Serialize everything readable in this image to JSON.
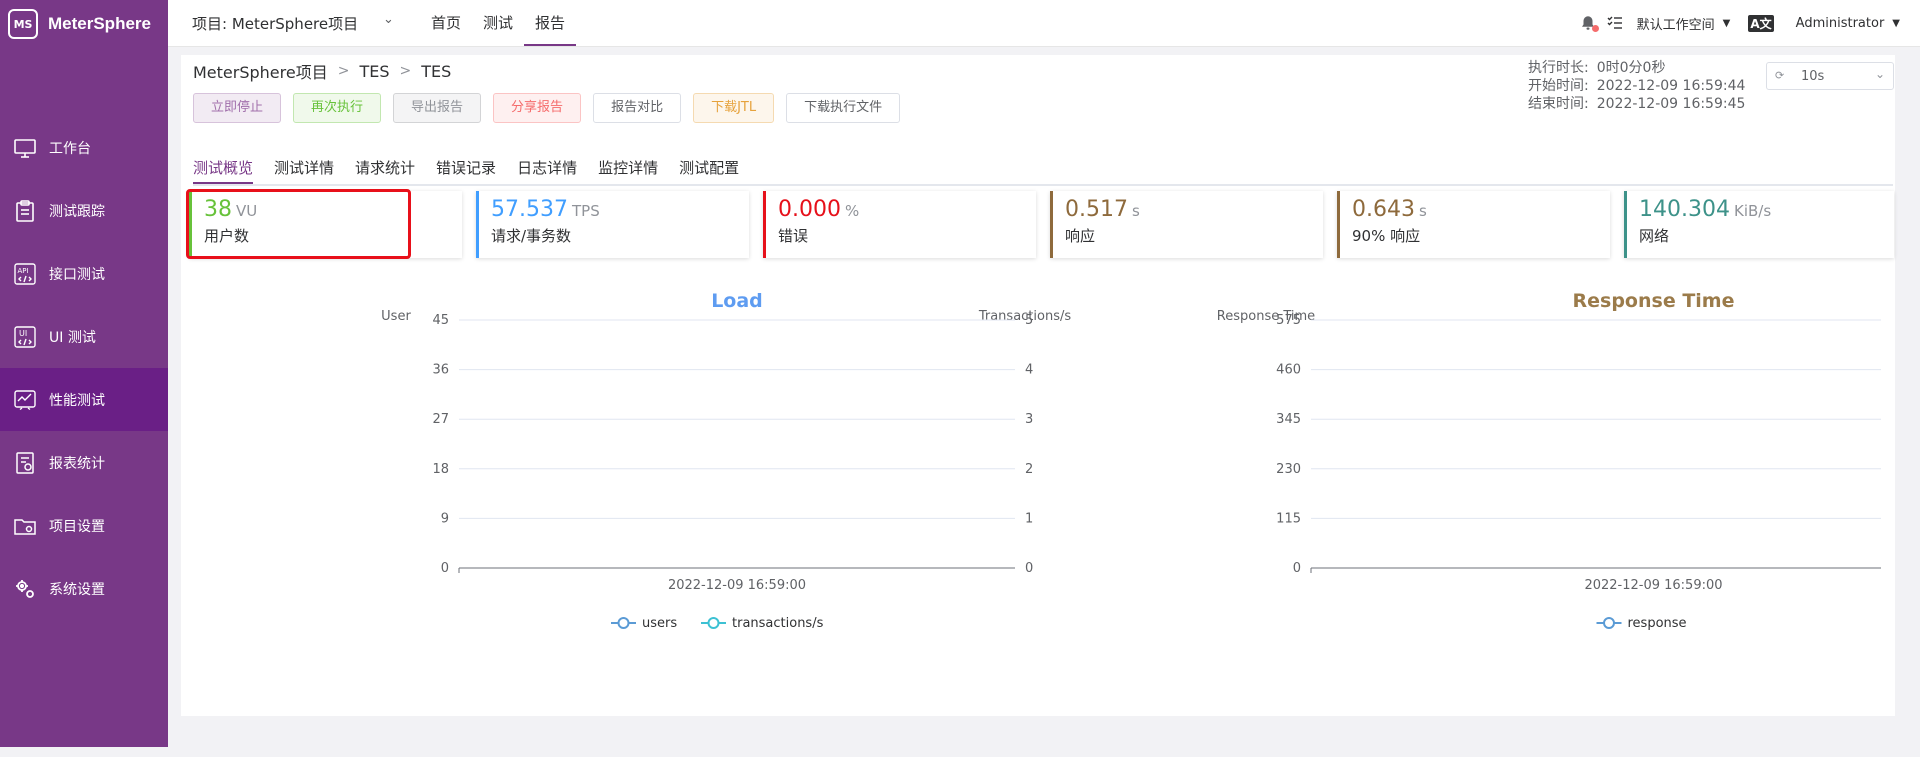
{
  "sidebar": {
    "logo_mark": "MS",
    "logo_text": "MeterSphere",
    "items": [
      {
        "label": "工作台",
        "icon": "monitor-icon"
      },
      {
        "label": "测试跟踪",
        "icon": "clipboard-icon"
      },
      {
        "label": "接口测试",
        "icon": "api-icon"
      },
      {
        "label": "UI 测试",
        "icon": "ui-icon"
      },
      {
        "label": "性能测试",
        "icon": "performance-icon"
      },
      {
        "label": "报表统计",
        "icon": "report-icon"
      },
      {
        "label": "项目设置",
        "icon": "folder-settings-icon"
      },
      {
        "label": "系统设置",
        "icon": "gears-icon"
      }
    ],
    "active_index": 4
  },
  "header": {
    "project": "项目: MeterSphere项目",
    "nav": [
      "首页",
      "测试",
      "报告"
    ],
    "active_nav": 2,
    "workspace": "默认工作空间",
    "user": "Administrator"
  },
  "report": {
    "breadcrumb": [
      "MeterSphere项目",
      "TES",
      "TES"
    ],
    "buttons": {
      "stop": "立即停止",
      "rerun": "再次执行",
      "export": "导出报告",
      "share": "分享报告",
      "compare": "报告对比",
      "jtl": "下载JTL",
      "download_files": "下载执行文件"
    },
    "duration_label": "执行时长:",
    "duration": "0时0分0秒",
    "start_label": "开始时间:",
    "start": "2022-12-09 16:59:44",
    "end_label": "结束时间:",
    "end": "2022-12-09 16:59:45",
    "refresh_interval": "10s",
    "tabs": [
      "测试概览",
      "测试详情",
      "请求统计",
      "错误记录",
      "日志详情",
      "监控详情",
      "测试配置"
    ],
    "active_tab": 0,
    "metrics": [
      {
        "value": "38",
        "unit": "VU",
        "label": "用户数",
        "color": "#67c23a"
      },
      {
        "value": "57.537",
        "unit": "TPS",
        "label": "请求/事务数",
        "color": "#409eff"
      },
      {
        "value": "0.000",
        "unit": "%",
        "label": "错误",
        "color": "#e6101a"
      },
      {
        "value": "0.517",
        "unit": "s",
        "label": "响应",
        "color": "#8e6a3c"
      },
      {
        "value": "0.643",
        "unit": "s",
        "label": "90% 响应",
        "color": "#8e6a3c"
      },
      {
        "value": "140.304",
        "unit": "KiB/s",
        "label": "网络",
        "color": "#3d9289"
      }
    ]
  },
  "chart_data": [
    {
      "type": "line",
      "title": "Load",
      "title_color": "#5e9cf1",
      "ylabel_left": "User",
      "ylabel_right": "Transactions/s",
      "y_left_ticks": [
        0,
        9,
        18,
        27,
        36,
        45
      ],
      "y_right_ticks": [
        0,
        1,
        2,
        3,
        4,
        5
      ],
      "ylim_left": [
        0,
        45
      ],
      "ylim_right": [
        0,
        5
      ],
      "x": [
        "2022-12-09 16:59:00"
      ],
      "series": [
        {
          "name": "users",
          "values": [],
          "color": "#5b9bd5"
        },
        {
          "name": "transactions/s",
          "values": [],
          "color": "#3dc1d3"
        }
      ],
      "legend": "bottom",
      "grid": true
    },
    {
      "type": "line",
      "title": "Response Time",
      "title_color": "#9b7b4a",
      "ylabel_left": "Response Time",
      "y_left_ticks": [
        0,
        115,
        230,
        345,
        460,
        575
      ],
      "ylim_left": [
        0,
        575
      ],
      "x": [
        "2022-12-09 16:59:00"
      ],
      "series": [
        {
          "name": "response",
          "values": [],
          "color": "#5b9bd5"
        }
      ],
      "legend": "bottom",
      "grid": true
    }
  ]
}
